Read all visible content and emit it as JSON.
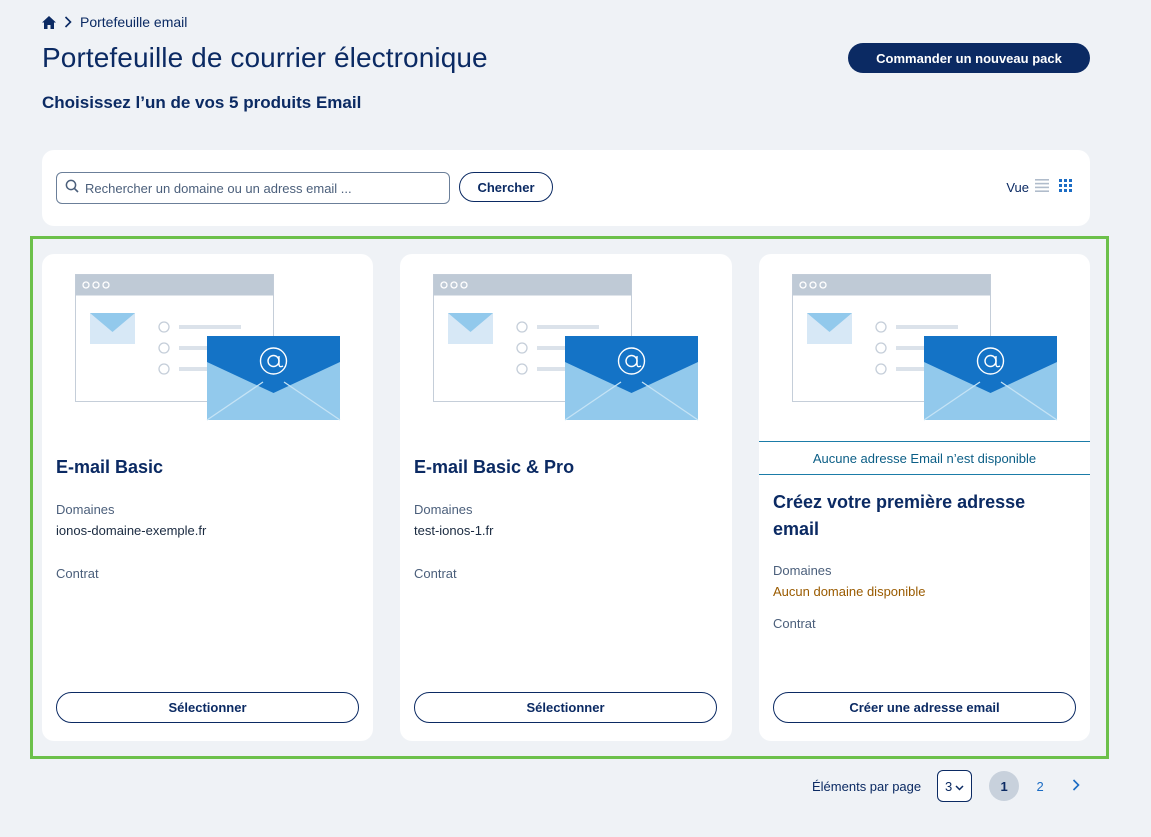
{
  "breadcrumb": {
    "current": "Portefeuille email"
  },
  "header": {
    "title": "Portefeuille de courrier électronique",
    "subtitle": "Choisissez l’un de vos 5 produits Email",
    "order_button": "Commander un nouveau pack"
  },
  "search": {
    "placeholder": "Rechercher un domaine ou un adress email ...",
    "value": "",
    "button": "Chercher",
    "view_label": "Vue"
  },
  "cards": [
    {
      "title": "E-mail Basic",
      "domains_label": "Domaines",
      "domain": "ionos-domaine-exemple.fr",
      "contract_label": "Contrat",
      "button": "Sélectionner"
    },
    {
      "title": "E-mail Basic & Pro",
      "domains_label": "Domaines",
      "domain": "test-ionos-1.fr",
      "contract_label": "Contrat",
      "button": "Sélectionner"
    },
    {
      "notice": "Aucune adresse Email n’est disponible",
      "title": "Créez votre première adresse email",
      "domains_label": "Domaines",
      "domain": "Aucun domaine disponible",
      "contract_label": "Contrat",
      "button": "Créer une adresse email"
    }
  ],
  "pagination": {
    "items_per_page_label": "Éléments par page",
    "page_size": "3",
    "pages": [
      "1",
      "2"
    ],
    "current_page": "1"
  },
  "icons": {
    "home": "home-icon",
    "chevron": "chevron-right-icon",
    "search": "search-icon",
    "list_view": "list-view-icon",
    "grid_view": "grid-view-icon",
    "envelope": "envelope-icon"
  },
  "colors": {
    "brand_navy": "#0b2a63",
    "background": "#eff2f6",
    "highlight": "#6cc04a",
    "envelope_dark": "#1473c6",
    "envelope_light": "#92c9ec",
    "warning": "#9a5b00"
  }
}
